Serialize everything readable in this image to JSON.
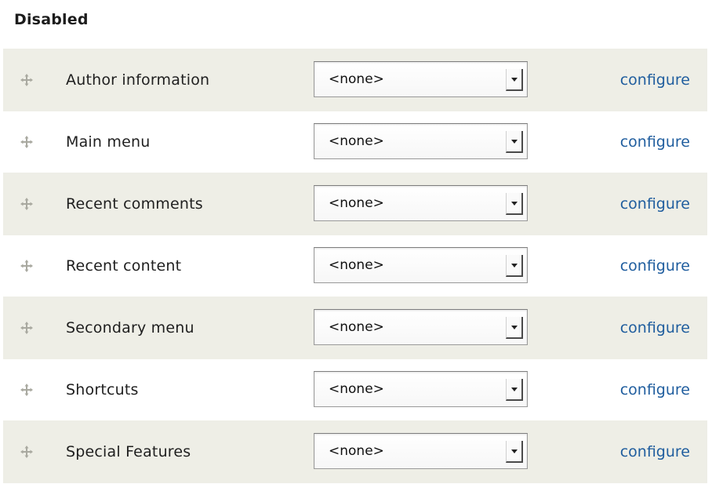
{
  "section": {
    "title": "Disabled"
  },
  "rows": [
    {
      "name": "Author information",
      "region": "<none>",
      "link": "configure"
    },
    {
      "name": "Main menu",
      "region": "<none>",
      "link": "configure"
    },
    {
      "name": "Recent comments",
      "region": "<none>",
      "link": "configure"
    },
    {
      "name": "Recent content",
      "region": "<none>",
      "link": "configure"
    },
    {
      "name": "Secondary menu",
      "region": "<none>",
      "link": "configure"
    },
    {
      "name": "Shortcuts",
      "region": "<none>",
      "link": "configure"
    },
    {
      "name": "Special Features",
      "region": "<none>",
      "link": "configure"
    }
  ],
  "icons": {
    "drag": "drag-handle-icon",
    "dropdown": "chevron-down-icon"
  },
  "colors": {
    "link": "#1f5d9e",
    "stripe": "#eeeee6"
  }
}
